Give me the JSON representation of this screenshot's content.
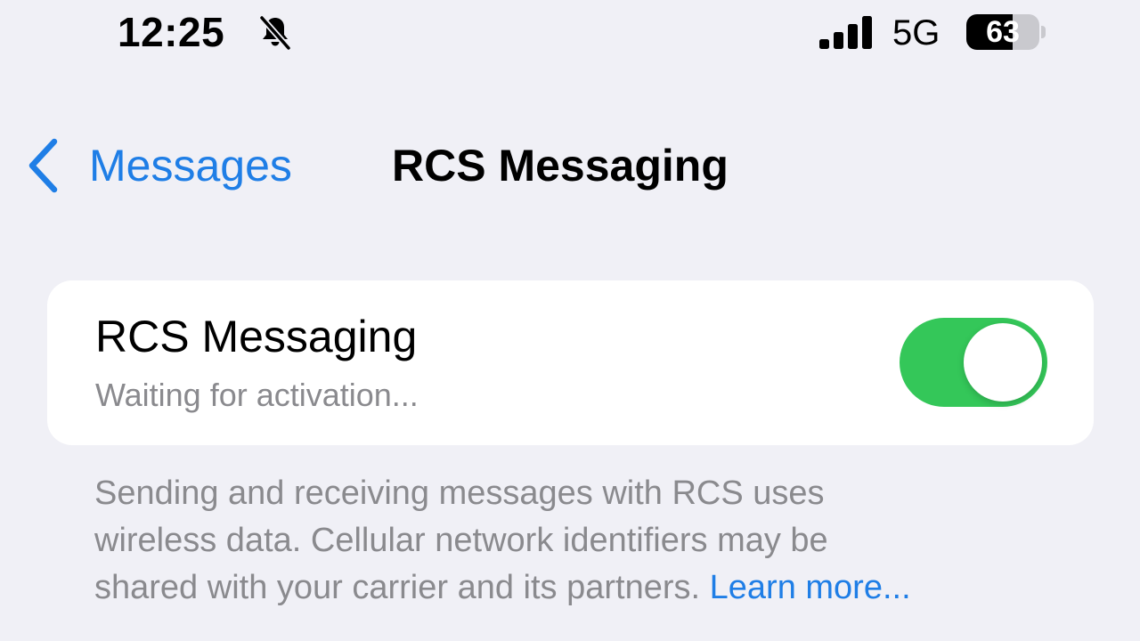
{
  "status_bar": {
    "time": "12:25",
    "mute_icon": "bell-slash-icon",
    "signal_icon": "cellular-signal-icon",
    "network": "5G",
    "battery_percent": "63",
    "battery_level": 0.63
  },
  "nav": {
    "back_label": "Messages",
    "back_icon": "chevron-left-icon",
    "title": "RCS Messaging"
  },
  "setting": {
    "title": "RCS Messaging",
    "subtitle": "Waiting for activation...",
    "toggle_on": true,
    "toggle_color": "#34c759"
  },
  "footer": {
    "line1": "Sending and receiving messages with RCS uses",
    "line2": "wireless data. Cellular network identifiers may be",
    "line3_text": "shared with your carrier and its partners.",
    "learn_more": "Learn more..."
  },
  "colors": {
    "accent": "#1f7ee6",
    "background": "#f0f0f6",
    "secondary_text": "#8a8a8e"
  }
}
